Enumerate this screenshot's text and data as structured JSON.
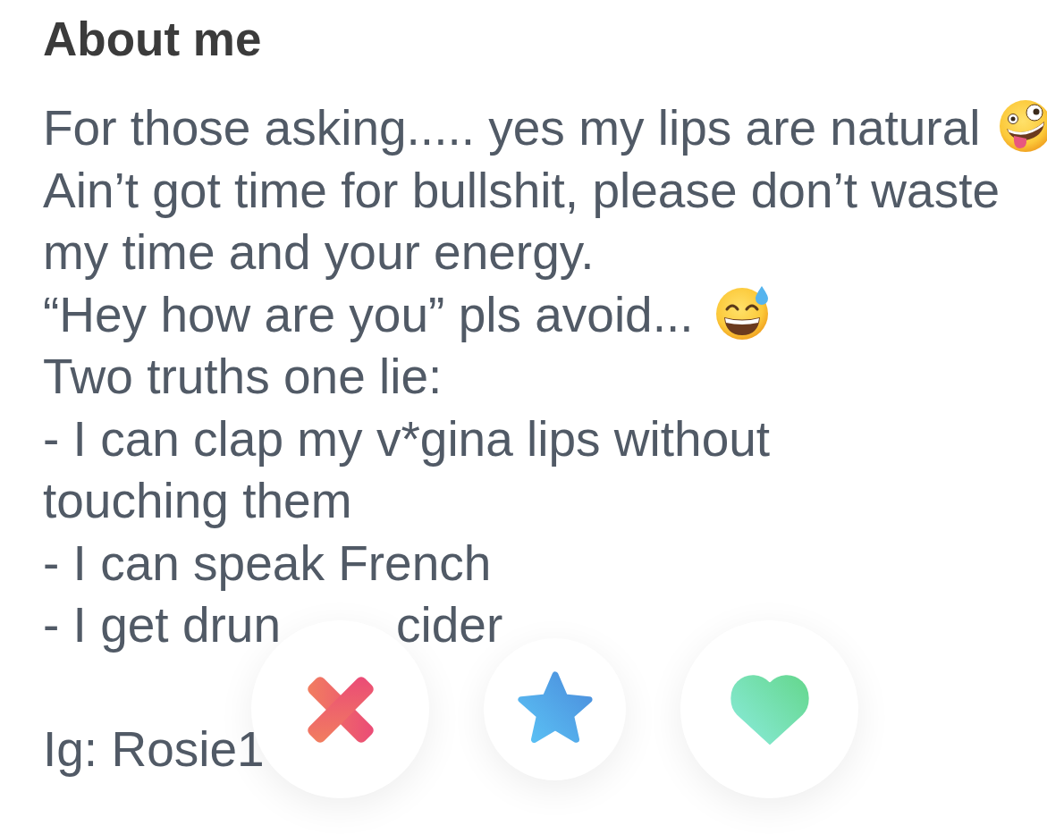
{
  "about_me": {
    "title": "About me",
    "paragraphs": [
      {
        "lines": [
          {
            "kind": "zany",
            "text": "For those asking..... yes my lips are natural"
          },
          {
            "kind": "plain",
            "text": "Ain’t got time for bullshit, please don’t waste my time and your energy."
          },
          {
            "kind": "sweatsmile",
            "text": "“Hey how are you” pls avoid..."
          },
          {
            "kind": "plain",
            "text": "Two truths one lie:"
          },
          {
            "kind": "plain",
            "text": "- I can clap my v*gina lips without"
          },
          {
            "kind": "plain",
            "text": "touching them"
          },
          {
            "kind": "plain",
            "text": "- I can speak French"
          },
          {
            "kind": "covered",
            "text": "- I get drun",
            "tail": "cider"
          }
        ]
      },
      {
        "lines": [
          {
            "kind": "plain",
            "text": "Ig: Rosie1"
          }
        ]
      }
    ]
  },
  "action_buttons": [
    {
      "kind": "nope"
    },
    {
      "kind": "superlike"
    },
    {
      "kind": "like"
    }
  ]
}
